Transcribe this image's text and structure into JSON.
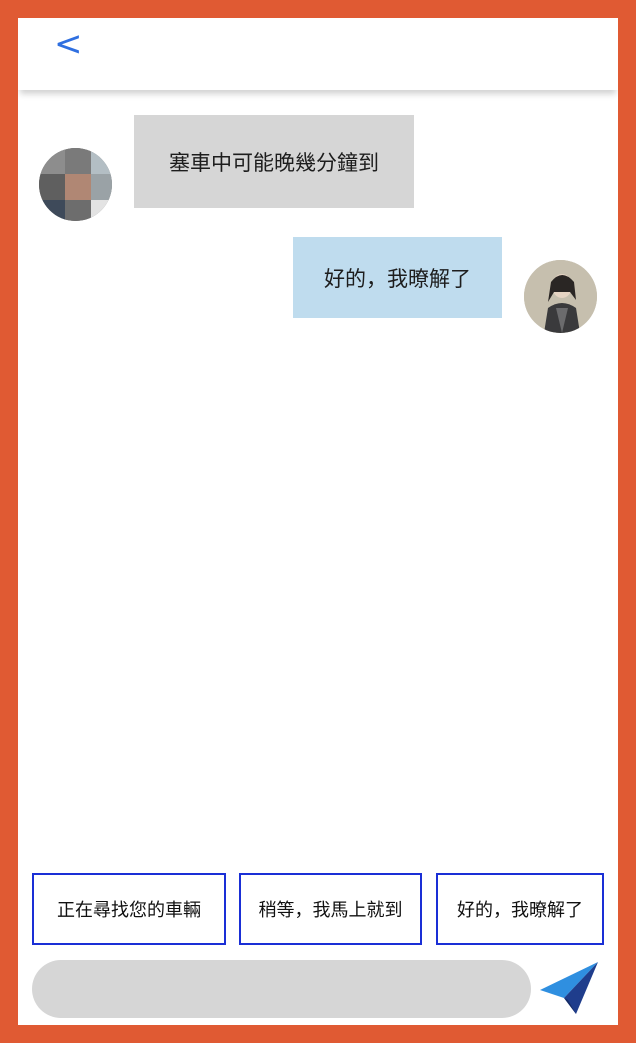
{
  "header": {
    "back_label": "<"
  },
  "messages": [
    {
      "sender": "driver",
      "text": "塞車中可能晚幾分鐘到"
    },
    {
      "sender": "me",
      "text": "好的，我暸解了"
    }
  ],
  "quick_replies": [
    "正在尋找您的車輛",
    "稍等，我馬上就到",
    "好的，我暸解了"
  ],
  "composer": {
    "value": "",
    "placeholder": ""
  },
  "colors": {
    "frame": "#e05a33",
    "accent": "#2f6fe0",
    "incoming_bubble": "#d6d6d6",
    "outgoing_bubble": "#bfdcee",
    "quick_reply_border": "#1a2fd6",
    "send_icon": "#2f8fe0"
  },
  "icons": {
    "back": "chevron-left-icon",
    "send": "paper-plane-icon"
  }
}
